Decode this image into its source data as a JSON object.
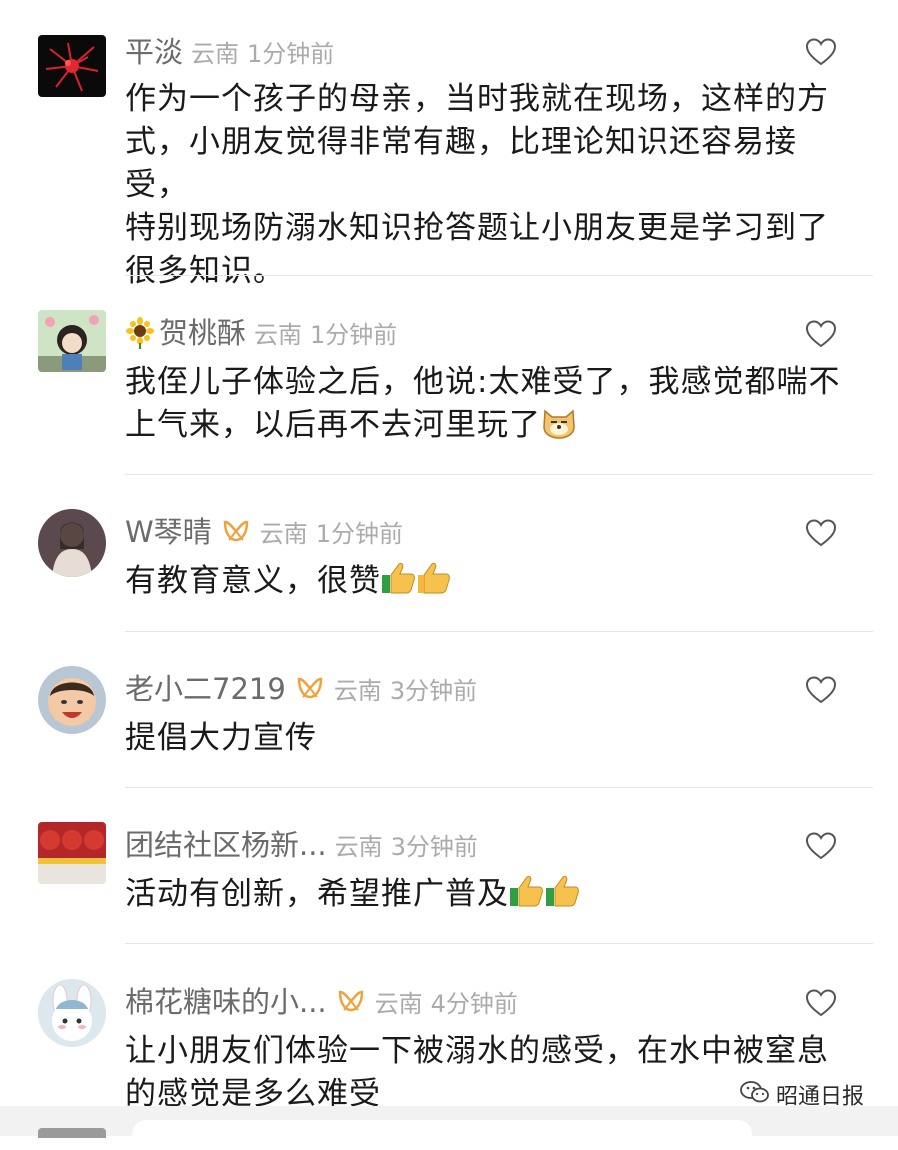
{
  "comments": [
    {
      "name": "平淡",
      "location": "云南",
      "time": "1分钟前",
      "text_lines": [
        "作为一个孩子的母亲，当时我就在现场，这样的方",
        "式，小朋友觉得非常有趣，比理论知识还容易接受，",
        "特别现场防溺水知识抢答题让小朋友更是学习到了",
        "很多知识。"
      ]
    },
    {
      "name": "贺桃酥",
      "name_prefix_icon": "sunflower-emoji",
      "location": "云南",
      "time": "1分钟前",
      "text_lines": [
        "我侄儿子体验之后，他说:太难受了，我感觉都喘不",
        "上气来，以后再不去河里玩了"
      ],
      "text_suffix_icon": "doge-emoji"
    },
    {
      "name": "W琴晴",
      "badge_icon": "vip-badge-icon",
      "location": "云南",
      "time": "1分钟前",
      "text_lines": [
        "有教育意义，很赞"
      ],
      "text_suffix_icon": "thumbs-up-emoji x2"
    },
    {
      "name": "老小二7219",
      "badge_icon": "vip-badge-icon",
      "location": "云南",
      "time": "3分钟前",
      "text_lines": [
        "提倡大力宣传"
      ]
    },
    {
      "name": "团结社区杨新...",
      "location": "云南",
      "time": "3分钟前",
      "text_lines": [
        "活动有创新，希望推广普及"
      ],
      "text_suffix_icon": "thumbs-up-emoji x2"
    },
    {
      "name": "棉花糖味的小...",
      "badge_icon": "vip-badge-icon",
      "location": "云南",
      "time": "4分钟前",
      "text_lines": [
        "让小朋友们体验一下被溺水的感受，在水中被窒息",
        "的感觉是多么难受"
      ]
    }
  ],
  "watermark": {
    "text": "昭通日报",
    "icon": "wechat-icon"
  },
  "colors": {
    "name": "#6b6b6b",
    "meta": "#ababab",
    "body": "#1a1a1a",
    "badge": "#f0a23c",
    "divider": "#e6e6e6"
  }
}
